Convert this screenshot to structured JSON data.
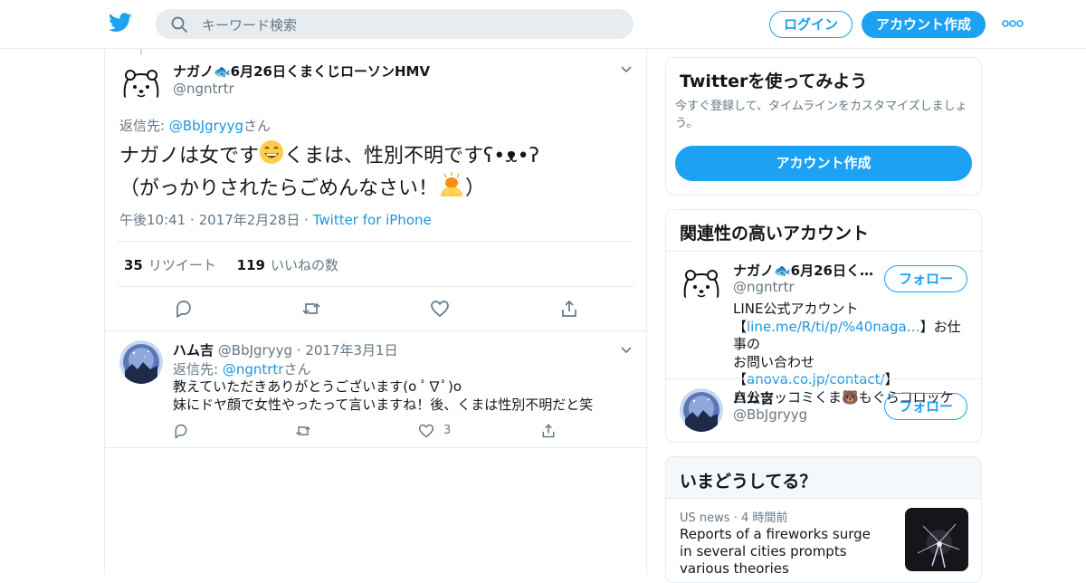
{
  "header": {
    "search_placeholder": "キーワード検索",
    "login_label": "ログイン",
    "signup_label": "アカウント作成"
  },
  "tweet": {
    "author_name": "ナガノ🐟6月26日くまくじローソンHMV",
    "author_handle": "@ngntrtr",
    "reply_to_prefix": "返信先: ",
    "reply_to_handle": "@BbJgryyg",
    "reply_to_suffix": "さん",
    "text_part1": "ナガノは女です",
    "text_part2": "くまは、性別不明です",
    "text_face": "ʕ•ᴥ•ʔ",
    "text_part3": "（がっかりされたらごめんなさい！",
    "text_part4": "）",
    "time": "午後10:41",
    "date": "2017年2月28日",
    "source": "Twitter for iPhone",
    "retweet_count": "35",
    "retweet_label": "リツイート",
    "like_count": "119",
    "like_label": "いいねの数"
  },
  "reply": {
    "author_name": "ハム吉",
    "author_handle": "@BbJgryyg",
    "date": "2017年3月1日",
    "reply_to_prefix": "返信先: ",
    "reply_to_handle": "@ngntrtr",
    "reply_to_suffix": "さん",
    "line1": "教えていただきありがとうございます(o ﾟ∇ﾟ)o",
    "line2": "妹にドヤ顔で女性やったって言いますね！後、くまは性別不明だと笑",
    "like_count": "3"
  },
  "sidebar": {
    "promo": {
      "title": "Twitterを使ってみよう",
      "desc": "今すぐ登録して、タイムラインをカスタマイズしましょう。",
      "button": "アカウント作成"
    },
    "related": {
      "title": "関連性の高いアカウント",
      "follow_label": "フォロー",
      "account1_name": "ナガノ🐟6月26日く…",
      "account1_handle": "@ngntrtr",
      "account1_bio_1": "LINE公式アカウント",
      "account1_bio_2a": "【",
      "account1_bio_2link": "line.me/R/ti/p/%40naga…",
      "account1_bio_2b": "】お仕事の",
      "account1_bio_3a": "お問い合わせ【",
      "account1_bio_3link": "anova.co.jp/contact/",
      "account1_bio_3b": "】",
      "account1_bio_4": "自分ツッコミくま🐻もぐらコロッケ",
      "account2_name": "ハム吉",
      "account2_handle": "@BbJgryyg"
    },
    "trends": {
      "title": "いまどうしてる？",
      "category": "US news",
      "age": "4 時間前",
      "headline": "Reports of a fireworks surge in several cities prompts various theories"
    }
  },
  "colors": {
    "brand": "#1da1f2",
    "link": "#1b95e0",
    "secondary_text": "#657786",
    "border": "#e6ecf0"
  },
  "icons": [
    "twitter-bird-icon",
    "search-icon",
    "more-dots-icon",
    "chevron-down-icon",
    "reply-icon",
    "retweet-icon",
    "like-icon",
    "share-icon"
  ]
}
